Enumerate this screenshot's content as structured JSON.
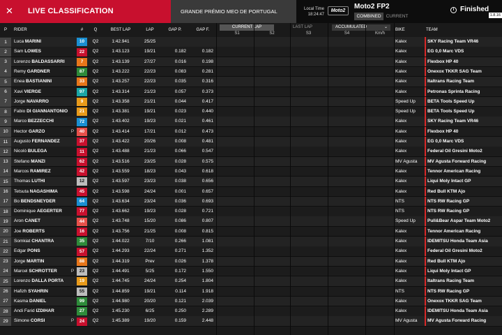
{
  "header": {
    "close_icon": "✕",
    "live_title": "LIVE CLASSIFICATION",
    "gp_name": "GRANDE PRÉMIO MEO DE PORTUGAL",
    "local_time_label": "Local Time",
    "local_time": "18:24:47",
    "logo_text": "Moto2",
    "session": "Moto2 FP2",
    "tab_combined": "COMBINED",
    "tab_current": "CURRENT",
    "status": "Finished",
    "status_icon": "i",
    "version": "1.8.16"
  },
  "columns": {
    "p": "P",
    "rider": "RIDER",
    "num": "#",
    "q": "Q",
    "best_lap": "BEST LAP",
    "lap": "LAP",
    "gap_p": "GAP P.",
    "gap_f": "GAP F.",
    "bike": "BIKE",
    "team": "TEAM"
  },
  "controls": {
    "current_lap": "CURRENT LAP",
    "last_lap": "LAST LAP",
    "accumulated": "ACCUMULATED",
    "s1": "S1",
    "s2": "S2",
    "s3": "S3",
    "s4": "S4",
    "speed": "Km/h"
  },
  "rows": [
    {
      "p": "1",
      "first": "Luca",
      "last": "MARINI",
      "flag": "",
      "num": "10",
      "numc": "#1a8fd1",
      "q": "Q2",
      "best": "1:42.941",
      "lap": "25/25",
      "gp": "",
      "gf": "",
      "bike": "Kalex",
      "team": "SKY Racing Team VR46"
    },
    {
      "p": "2",
      "first": "Sam",
      "last": "LOWES",
      "flag": "",
      "num": "22",
      "numc": "#c8102e",
      "q": "Q2",
      "best": "1:43.123",
      "lap": "19/21",
      "gp": "0.182",
      "gf": "0.182",
      "bike": "Kalex",
      "team": "EG 0,0 Marc VDS"
    },
    {
      "p": "3",
      "first": "Lorenzo",
      "last": "BALDASSARRI",
      "flag": "",
      "num": "7",
      "numc": "#e8761a",
      "q": "Q2",
      "best": "1:43.139",
      "lap": "27/27",
      "gp": "0.016",
      "gf": "0.198",
      "bike": "Kalex",
      "team": "Flexbox HP 40"
    },
    {
      "p": "4",
      "first": "Remy",
      "last": "GARDNER",
      "flag": "",
      "num": "87",
      "numc": "#2e8b3a",
      "q": "Q2",
      "best": "1:43.222",
      "lap": "22/23",
      "gp": "0.083",
      "gf": "0.281",
      "bike": "Kalex",
      "team": "Onexox TKKR SAG Team"
    },
    {
      "p": "5",
      "first": "Enea",
      "last": "BASTIANINI",
      "flag": "",
      "num": "33",
      "numc": "#e8761a",
      "q": "Q2",
      "best": "1:43.257",
      "lap": "22/23",
      "gp": "0.035",
      "gf": "0.316",
      "bike": "Kalex",
      "team": "Italtrans Racing Team"
    },
    {
      "p": "6",
      "first": "Xavi",
      "last": "VIERGE",
      "flag": "",
      "num": "97",
      "numc": "#1aa6a6",
      "q": "Q2",
      "best": "1:43.314",
      "lap": "21/23",
      "gp": "0.057",
      "gf": "0.373",
      "bike": "Kalex",
      "team": "Petronas Sprinta Racing"
    },
    {
      "p": "7",
      "first": "Jorge",
      "last": "NAVARRO",
      "flag": "",
      "num": "9",
      "numc": "#e89a1a",
      "q": "Q2",
      "best": "1:43.358",
      "lap": "21/21",
      "gp": "0.044",
      "gf": "0.417",
      "bike": "Speed Up",
      "team": "BETA Tools Speed Up"
    },
    {
      "p": "8",
      "first": "Fabio",
      "last": "DI GIANNANTONIO",
      "flag": "",
      "num": "21",
      "numc": "#e89a1a",
      "q": "Q2",
      "best": "1:43.381",
      "lap": "19/21",
      "gp": "0.023",
      "gf": "0.440",
      "bike": "Speed Up",
      "team": "BETA Tools Speed Up"
    },
    {
      "p": "9",
      "first": "Marco",
      "last": "BEZZECCHI",
      "flag": "",
      "num": "72",
      "numc": "#1a8fd1",
      "q": "Q2",
      "best": "1:43.402",
      "lap": "19/23",
      "gp": "0.021",
      "gf": "0.461",
      "bike": "Kalex",
      "team": "SKY Racing Team VR46"
    },
    {
      "p": "10",
      "first": "Hector",
      "last": "GARZO",
      "flag": "P",
      "num": "40",
      "numc": "#e8504a",
      "q": "Q2",
      "best": "1:43.414",
      "lap": "17/21",
      "gp": "0.012",
      "gf": "0.473",
      "bike": "Kalex",
      "team": "Flexbox HP 40"
    },
    {
      "p": "11",
      "first": "Augusto",
      "last": "FERNANDEZ",
      "flag": "",
      "num": "37",
      "numc": "#c8102e",
      "q": "Q2",
      "best": "1:43.422",
      "lap": "20/26",
      "gp": "0.008",
      "gf": "0.481",
      "bike": "Kalex",
      "team": "EG 0,0 Marc VDS"
    },
    {
      "p": "12",
      "first": "Nicolò",
      "last": "BULEGA",
      "flag": "",
      "num": "11",
      "numc": "#c8102e",
      "q": "Q2",
      "best": "1:43.488",
      "lap": "21/23",
      "gp": "0.066",
      "gf": "0.547",
      "bike": "Kalex",
      "team": "Federal Oil Gresini Moto2"
    },
    {
      "p": "13",
      "first": "Stefano",
      "last": "MANZI",
      "flag": "",
      "num": "62",
      "numc": "#c8102e",
      "q": "Q2",
      "best": "1:43.516",
      "lap": "23/25",
      "gp": "0.028",
      "gf": "0.575",
      "bike": "MV Agusta",
      "team": "MV Agusta Forward Racing"
    },
    {
      "p": "14",
      "first": "Marcos",
      "last": "RAMIREZ",
      "flag": "",
      "num": "42",
      "numc": "#c8102e",
      "q": "Q2",
      "best": "1:43.559",
      "lap": "18/23",
      "gp": "0.043",
      "gf": "0.618",
      "bike": "Kalex",
      "team": "Tennor American Racing"
    },
    {
      "p": "15",
      "first": "Thomas",
      "last": "LUTHI",
      "flag": "",
      "num": "12",
      "numc": "#bdbdbd",
      "q": "Q2",
      "best": "1:43.597",
      "lap": "23/23",
      "gp": "0.038",
      "gf": "0.656",
      "bike": "Kalex",
      "team": "Liqui Moly Intact GP"
    },
    {
      "p": "16",
      "first": "Tetsuta",
      "last": "NAGASHIMA",
      "flag": "",
      "num": "45",
      "numc": "#c8102e",
      "q": "Q2",
      "best": "1:43.598",
      "lap": "24/24",
      "gp": "0.001",
      "gf": "0.657",
      "bike": "Kalex",
      "team": "Red Bull KTM Ajo"
    },
    {
      "p": "17",
      "first": "Bo",
      "last": "BENDSNEYDER",
      "flag": "",
      "num": "64",
      "numc": "#1a8fd1",
      "q": "Q2",
      "best": "1:43.634",
      "lap": "23/24",
      "gp": "0.036",
      "gf": "0.693",
      "bike": "NTS",
      "team": "NTS RW Racing GP"
    },
    {
      "p": "18",
      "first": "Dominique",
      "last": "AEGERTER",
      "flag": "",
      "num": "77",
      "numc": "#c8102e",
      "q": "Q2",
      "best": "1:43.662",
      "lap": "19/23",
      "gp": "0.028",
      "gf": "0.721",
      "bike": "NTS",
      "team": "NTS RW Racing GP"
    },
    {
      "p": "19",
      "first": "Aron",
      "last": "CANET",
      "flag": "",
      "num": "44",
      "numc": "#e8504a",
      "q": "Q2",
      "best": "1:43.748",
      "lap": "15/20",
      "gp": "0.086",
      "gf": "0.807",
      "bike": "Speed Up",
      "team": "Pull&Bear Aspar Team Moto2"
    },
    {
      "p": "20",
      "first": "Joe",
      "last": "ROBERTS",
      "flag": "",
      "num": "16",
      "numc": "#c8102e",
      "q": "Q2",
      "best": "1:43.756",
      "lap": "21/25",
      "gp": "0.008",
      "gf": "0.815",
      "bike": "Kalex",
      "team": "Tennor American Racing"
    },
    {
      "p": "21",
      "first": "Somkiat",
      "last": "CHANTRA",
      "flag": "",
      "num": "35",
      "numc": "#2e8b3a",
      "q": "Q2",
      "best": "1:44.022",
      "lap": "7/10",
      "gp": "0.266",
      "gf": "1.081",
      "bike": "Kalex",
      "team": "IDEMITSU Honda Team Asia"
    },
    {
      "p": "22",
      "first": "Edgar",
      "last": "PONS",
      "flag": "",
      "num": "57",
      "numc": "#c8102e",
      "q": "Q2",
      "best": "1:44.293",
      "lap": "22/24",
      "gp": "0.271",
      "gf": "1.352",
      "bike": "Kalex",
      "team": "Federal Oil Gresini Moto2"
    },
    {
      "p": "23",
      "first": "Jorge",
      "last": "MARTIN",
      "flag": "",
      "num": "88",
      "numc": "#e8761a",
      "q": "Q2",
      "best": "1:44.319",
      "lap": "Prev",
      "gp": "0.026",
      "gf": "1.378",
      "bike": "Kalex",
      "team": "Red Bull KTM Ajo"
    },
    {
      "p": "24",
      "first": "Marcel",
      "last": "SCHROTTER",
      "flag": "P",
      "num": "23",
      "numc": "#bdbdbd",
      "q": "Q2",
      "best": "1:44.491",
      "lap": "5/25",
      "gp": "0.172",
      "gf": "1.550",
      "bike": "Kalex",
      "team": "Liqui Moly Intact GP"
    },
    {
      "p": "25",
      "first": "Lorenzo",
      "last": "DALLA PORTA",
      "flag": "",
      "num": "19",
      "numc": "#e89a1a",
      "q": "Q2",
      "best": "1:44.745",
      "lap": "24/24",
      "gp": "0.254",
      "gf": "1.804",
      "bike": "Kalex",
      "team": "Italtrans Racing Team"
    },
    {
      "p": "26",
      "first": "Hafizh",
      "last": "SYAHRIN",
      "flag": "",
      "num": "55",
      "numc": "#bdbdbd",
      "q": "Q2",
      "best": "1:44.859",
      "lap": "19/21",
      "gp": "0.114",
      "gf": "1.918",
      "bike": "NTS",
      "team": "NTS RW Racing GP"
    },
    {
      "p": "27",
      "first": "Kasma",
      "last": "DANIEL",
      "flag": "",
      "num": "99",
      "numc": "#2e8b3a",
      "q": "Q2",
      "best": "1:44.980",
      "lap": "20/20",
      "gp": "0.121",
      "gf": "2.039",
      "bike": "Kalex",
      "team": "Onexox TKKR SAG Team"
    },
    {
      "p": "28",
      "first": "Andi Farid",
      "last": "IZDIHAR",
      "flag": "",
      "num": "27",
      "numc": "#2e8b3a",
      "q": "Q2",
      "best": "1:45.230",
      "lap": "6/25",
      "gp": "0.250",
      "gf": "2.289",
      "bike": "Kalex",
      "team": "IDEMITSU Honda Team Asia"
    },
    {
      "p": "29",
      "first": "Simone",
      "last": "CORSI",
      "flag": "P",
      "num": "24",
      "numc": "#c8102e",
      "q": "Q2",
      "best": "1:45.389",
      "lap": "19/20",
      "gp": "0.159",
      "gf": "2.448",
      "bike": "MV Agusta",
      "team": "MV Agusta Forward Racing"
    }
  ]
}
